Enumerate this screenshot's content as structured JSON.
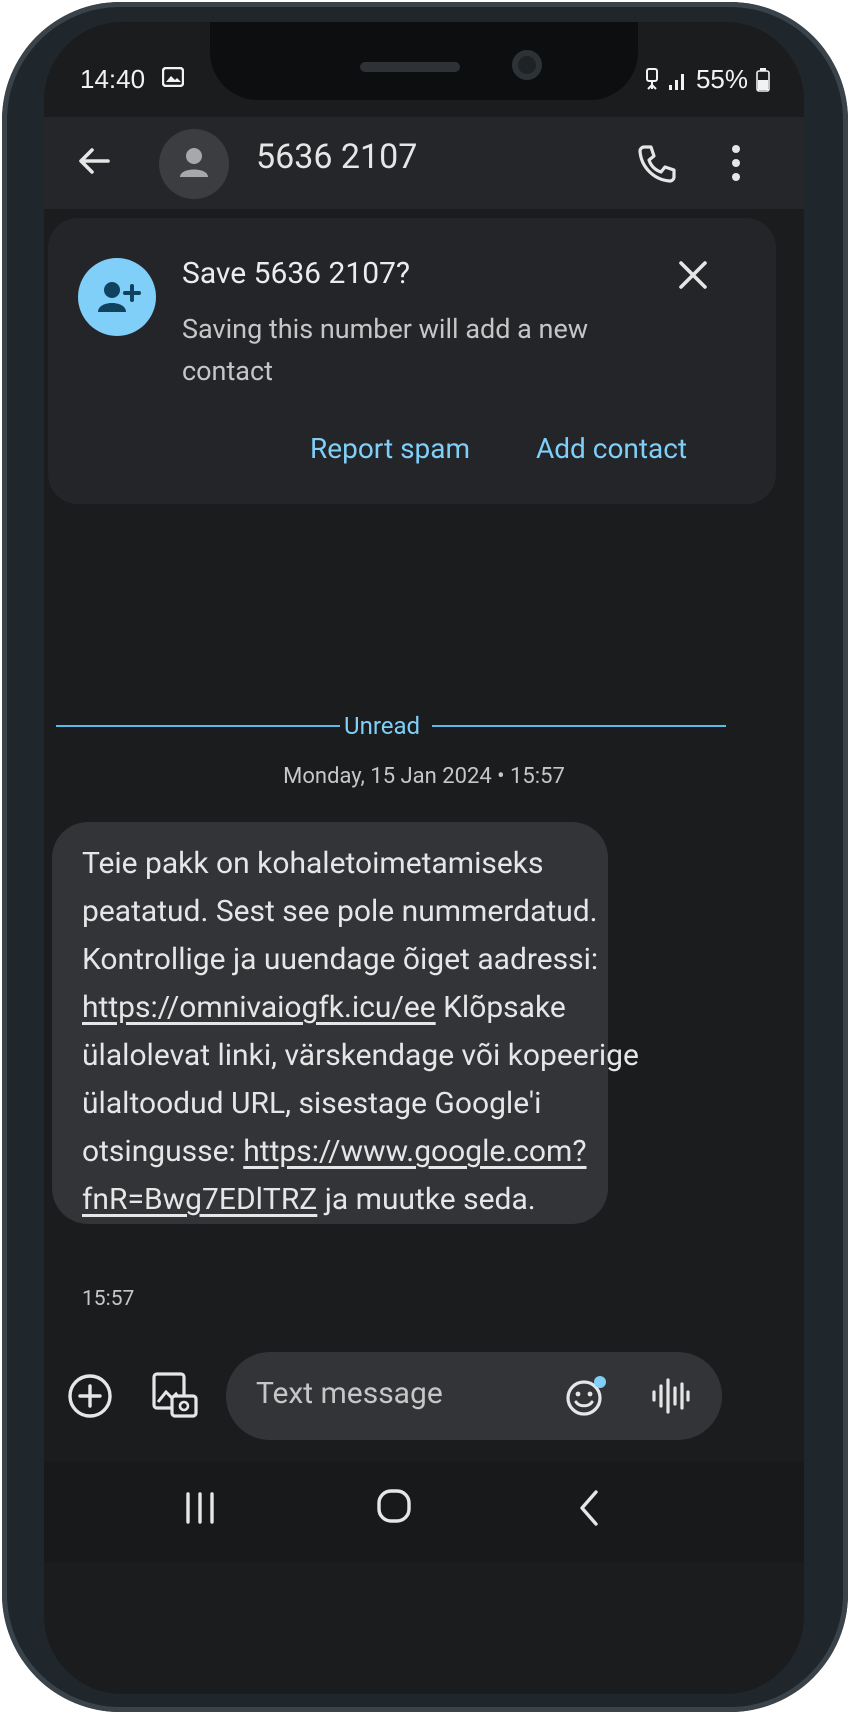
{
  "status_bar": {
    "time": "14:40",
    "battery": "55%",
    "icons": [
      "image-icon",
      "hotspot-icon",
      "signal-icon",
      "battery-icon"
    ]
  },
  "conversation": {
    "contact_name": "5636 2107",
    "icons": [
      "back-arrow-icon",
      "avatar-icon",
      "phone-icon",
      "more-vert-icon"
    ]
  },
  "save_card": {
    "title": "Save 5636 2107?",
    "description": "Saving this number will add a new contact",
    "report_label": "Report spam",
    "add_label": "Add contact",
    "icons": [
      "add-person-icon",
      "close-icon"
    ],
    "accent": "#7fcff9"
  },
  "thread": {
    "unread_label": "Unread",
    "date_label": "Monday, 15 Jan 2024 • 15:57",
    "message": {
      "part1": "Teie pakk on kohaletoimetamiseks peatatud. Sest see pole nummerdatud. Kontrollige ja uuendage õiget aadressi: ",
      "link1": "https://omnivaiogfk.icu/ee",
      "part2": " Klõpsake ülalolevat linki, värskendage või kopeerige ülaltoodud URL, sisestage Google'i otsingusse: ",
      "link2": "https://www.google.com?fnR=Bwg7EDlTRZ",
      "part3": " ja muutke seda.",
      "time": "15:57"
    }
  },
  "composer": {
    "placeholder": "Text message",
    "icons": [
      "add-circle-icon",
      "gallery-icon",
      "emoji-icon",
      "voice-icon"
    ]
  },
  "nav_bar": {
    "icons": [
      "recent-apps-icon",
      "home-icon",
      "back-icon"
    ]
  }
}
